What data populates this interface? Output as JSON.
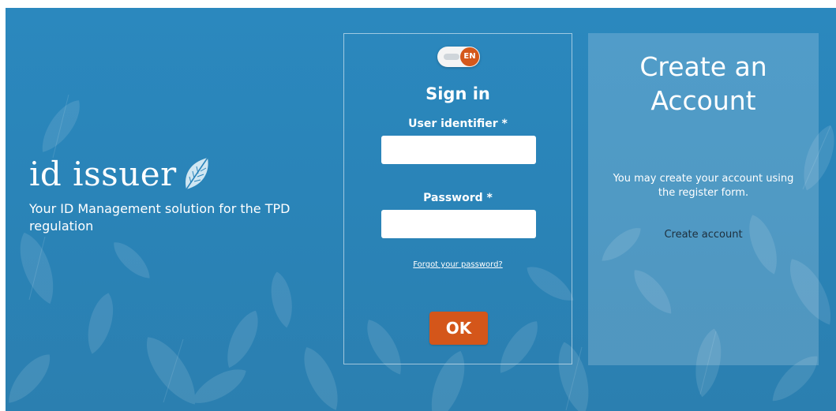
{
  "brand": {
    "logo_text": "id issuer",
    "logo_icon": "leaf-icon",
    "tagline": "Your ID Management solution for the TPD regulation"
  },
  "signin": {
    "language": "EN",
    "title": "Sign in",
    "user_label": "User identifier *",
    "user_value": "",
    "password_label": "Password *",
    "password_value": "",
    "forgot_link": "Forgot your password?",
    "ok_label": "OK"
  },
  "create_account": {
    "title": "Create an Account",
    "description": "You may create your account using the register form.",
    "link": "Create account"
  },
  "colors": {
    "background": "#2b85bb",
    "accent": "#d4561a",
    "panel": "rgba(255,255,255,0.18)"
  }
}
